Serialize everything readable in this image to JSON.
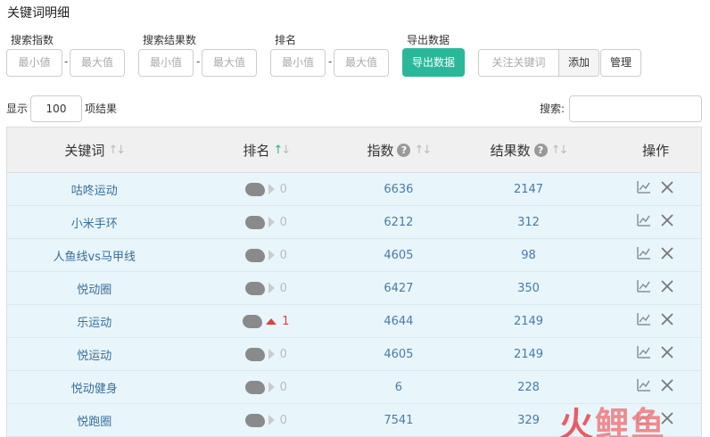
{
  "page_title": "关键词明细",
  "filters": [
    {
      "label": "搜索指数",
      "min_placeholder": "最小値",
      "max_placeholder": "最大值"
    },
    {
      "label": "搜索结果数",
      "min_placeholder": "最小值",
      "max_placeholder": "最大值"
    },
    {
      "label": "排名",
      "min_placeholder": "最小值",
      "max_placeholder": "最大值"
    }
  ],
  "export": {
    "label": "导出数据",
    "button": "导出数据",
    "color": "#2bb89a"
  },
  "watch": {
    "placeholder": "关注关键词",
    "add_label": "添加",
    "manage_label": "管理"
  },
  "paging": {
    "show_label": "显示",
    "page_size": "100",
    "result_label": "项结果"
  },
  "search": {
    "label": "搜索:"
  },
  "table": {
    "headers": [
      "关键词",
      "排名",
      "指数",
      "结果数",
      "操作"
    ],
    "rows": [
      {
        "keyword": "咕咚运动",
        "rank": "0",
        "trend": "flat",
        "index": "6636",
        "results": "2147"
      },
      {
        "keyword": "小米手环",
        "rank": "0",
        "trend": "flat",
        "index": "6212",
        "results": "312"
      },
      {
        "keyword": "人鱼线vs马甲线",
        "rank": "0",
        "trend": "flat",
        "index": "4605",
        "results": "98"
      },
      {
        "keyword": "悦动圈",
        "rank": "0",
        "trend": "flat",
        "index": "6427",
        "results": "350"
      },
      {
        "keyword": "乐运动",
        "rank": "1",
        "trend": "up",
        "index": "4644",
        "results": "2149"
      },
      {
        "keyword": "悦运动",
        "rank": "0",
        "trend": "flat",
        "index": "4605",
        "results": "2149"
      },
      {
        "keyword": "悦动健身",
        "rank": "0",
        "trend": "flat",
        "index": "6",
        "results": "228"
      },
      {
        "keyword": "悦跑圈",
        "rank": "0",
        "trend": "flat",
        "index": "7541",
        "results": "329"
      }
    ]
  },
  "watermark": {
    "text_1": "火",
    "text_2": "鲤鱼"
  }
}
